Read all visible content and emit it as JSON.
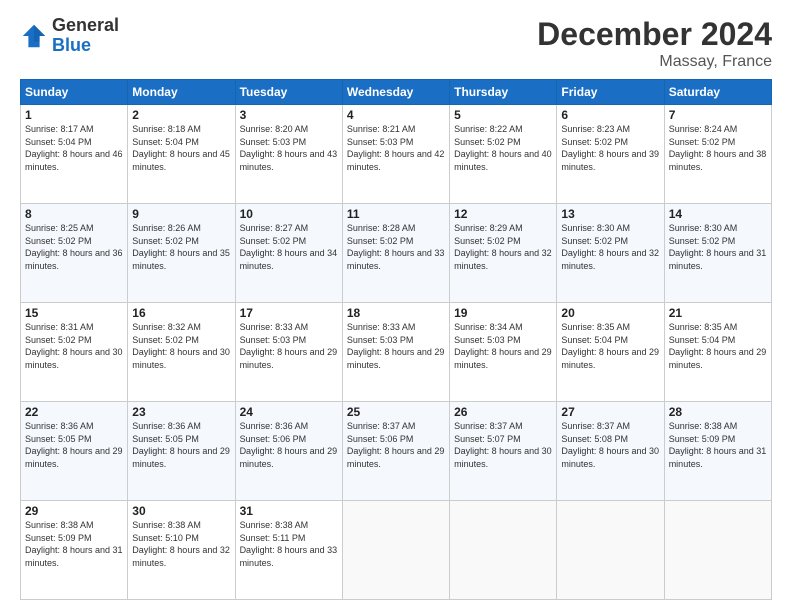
{
  "header": {
    "logo_general": "General",
    "logo_blue": "Blue",
    "month": "December 2024",
    "location": "Massay, France"
  },
  "weekdays": [
    "Sunday",
    "Monday",
    "Tuesday",
    "Wednesday",
    "Thursday",
    "Friday",
    "Saturday"
  ],
  "weeks": [
    [
      {
        "day": "1",
        "sunrise": "Sunrise: 8:17 AM",
        "sunset": "Sunset: 5:04 PM",
        "daylight": "Daylight: 8 hours and 46 minutes."
      },
      {
        "day": "2",
        "sunrise": "Sunrise: 8:18 AM",
        "sunset": "Sunset: 5:04 PM",
        "daylight": "Daylight: 8 hours and 45 minutes."
      },
      {
        "day": "3",
        "sunrise": "Sunrise: 8:20 AM",
        "sunset": "Sunset: 5:03 PM",
        "daylight": "Daylight: 8 hours and 43 minutes."
      },
      {
        "day": "4",
        "sunrise": "Sunrise: 8:21 AM",
        "sunset": "Sunset: 5:03 PM",
        "daylight": "Daylight: 8 hours and 42 minutes."
      },
      {
        "day": "5",
        "sunrise": "Sunrise: 8:22 AM",
        "sunset": "Sunset: 5:02 PM",
        "daylight": "Daylight: 8 hours and 40 minutes."
      },
      {
        "day": "6",
        "sunrise": "Sunrise: 8:23 AM",
        "sunset": "Sunset: 5:02 PM",
        "daylight": "Daylight: 8 hours and 39 minutes."
      },
      {
        "day": "7",
        "sunrise": "Sunrise: 8:24 AM",
        "sunset": "Sunset: 5:02 PM",
        "daylight": "Daylight: 8 hours and 38 minutes."
      }
    ],
    [
      {
        "day": "8",
        "sunrise": "Sunrise: 8:25 AM",
        "sunset": "Sunset: 5:02 PM",
        "daylight": "Daylight: 8 hours and 36 minutes."
      },
      {
        "day": "9",
        "sunrise": "Sunrise: 8:26 AM",
        "sunset": "Sunset: 5:02 PM",
        "daylight": "Daylight: 8 hours and 35 minutes."
      },
      {
        "day": "10",
        "sunrise": "Sunrise: 8:27 AM",
        "sunset": "Sunset: 5:02 PM",
        "daylight": "Daylight: 8 hours and 34 minutes."
      },
      {
        "day": "11",
        "sunrise": "Sunrise: 8:28 AM",
        "sunset": "Sunset: 5:02 PM",
        "daylight": "Daylight: 8 hours and 33 minutes."
      },
      {
        "day": "12",
        "sunrise": "Sunrise: 8:29 AM",
        "sunset": "Sunset: 5:02 PM",
        "daylight": "Daylight: 8 hours and 32 minutes."
      },
      {
        "day": "13",
        "sunrise": "Sunrise: 8:30 AM",
        "sunset": "Sunset: 5:02 PM",
        "daylight": "Daylight: 8 hours and 32 minutes."
      },
      {
        "day": "14",
        "sunrise": "Sunrise: 8:30 AM",
        "sunset": "Sunset: 5:02 PM",
        "daylight": "Daylight: 8 hours and 31 minutes."
      }
    ],
    [
      {
        "day": "15",
        "sunrise": "Sunrise: 8:31 AM",
        "sunset": "Sunset: 5:02 PM",
        "daylight": "Daylight: 8 hours and 30 minutes."
      },
      {
        "day": "16",
        "sunrise": "Sunrise: 8:32 AM",
        "sunset": "Sunset: 5:02 PM",
        "daylight": "Daylight: 8 hours and 30 minutes."
      },
      {
        "day": "17",
        "sunrise": "Sunrise: 8:33 AM",
        "sunset": "Sunset: 5:03 PM",
        "daylight": "Daylight: 8 hours and 29 minutes."
      },
      {
        "day": "18",
        "sunrise": "Sunrise: 8:33 AM",
        "sunset": "Sunset: 5:03 PM",
        "daylight": "Daylight: 8 hours and 29 minutes."
      },
      {
        "day": "19",
        "sunrise": "Sunrise: 8:34 AM",
        "sunset": "Sunset: 5:03 PM",
        "daylight": "Daylight: 8 hours and 29 minutes."
      },
      {
        "day": "20",
        "sunrise": "Sunrise: 8:35 AM",
        "sunset": "Sunset: 5:04 PM",
        "daylight": "Daylight: 8 hours and 29 minutes."
      },
      {
        "day": "21",
        "sunrise": "Sunrise: 8:35 AM",
        "sunset": "Sunset: 5:04 PM",
        "daylight": "Daylight: 8 hours and 29 minutes."
      }
    ],
    [
      {
        "day": "22",
        "sunrise": "Sunrise: 8:36 AM",
        "sunset": "Sunset: 5:05 PM",
        "daylight": "Daylight: 8 hours and 29 minutes."
      },
      {
        "day": "23",
        "sunrise": "Sunrise: 8:36 AM",
        "sunset": "Sunset: 5:05 PM",
        "daylight": "Daylight: 8 hours and 29 minutes."
      },
      {
        "day": "24",
        "sunrise": "Sunrise: 8:36 AM",
        "sunset": "Sunset: 5:06 PM",
        "daylight": "Daylight: 8 hours and 29 minutes."
      },
      {
        "day": "25",
        "sunrise": "Sunrise: 8:37 AM",
        "sunset": "Sunset: 5:06 PM",
        "daylight": "Daylight: 8 hours and 29 minutes."
      },
      {
        "day": "26",
        "sunrise": "Sunrise: 8:37 AM",
        "sunset": "Sunset: 5:07 PM",
        "daylight": "Daylight: 8 hours and 30 minutes."
      },
      {
        "day": "27",
        "sunrise": "Sunrise: 8:37 AM",
        "sunset": "Sunset: 5:08 PM",
        "daylight": "Daylight: 8 hours and 30 minutes."
      },
      {
        "day": "28",
        "sunrise": "Sunrise: 8:38 AM",
        "sunset": "Sunset: 5:09 PM",
        "daylight": "Daylight: 8 hours and 31 minutes."
      }
    ],
    [
      {
        "day": "29",
        "sunrise": "Sunrise: 8:38 AM",
        "sunset": "Sunset: 5:09 PM",
        "daylight": "Daylight: 8 hours and 31 minutes."
      },
      {
        "day": "30",
        "sunrise": "Sunrise: 8:38 AM",
        "sunset": "Sunset: 5:10 PM",
        "daylight": "Daylight: 8 hours and 32 minutes."
      },
      {
        "day": "31",
        "sunrise": "Sunrise: 8:38 AM",
        "sunset": "Sunset: 5:11 PM",
        "daylight": "Daylight: 8 hours and 33 minutes."
      },
      null,
      null,
      null,
      null
    ]
  ]
}
